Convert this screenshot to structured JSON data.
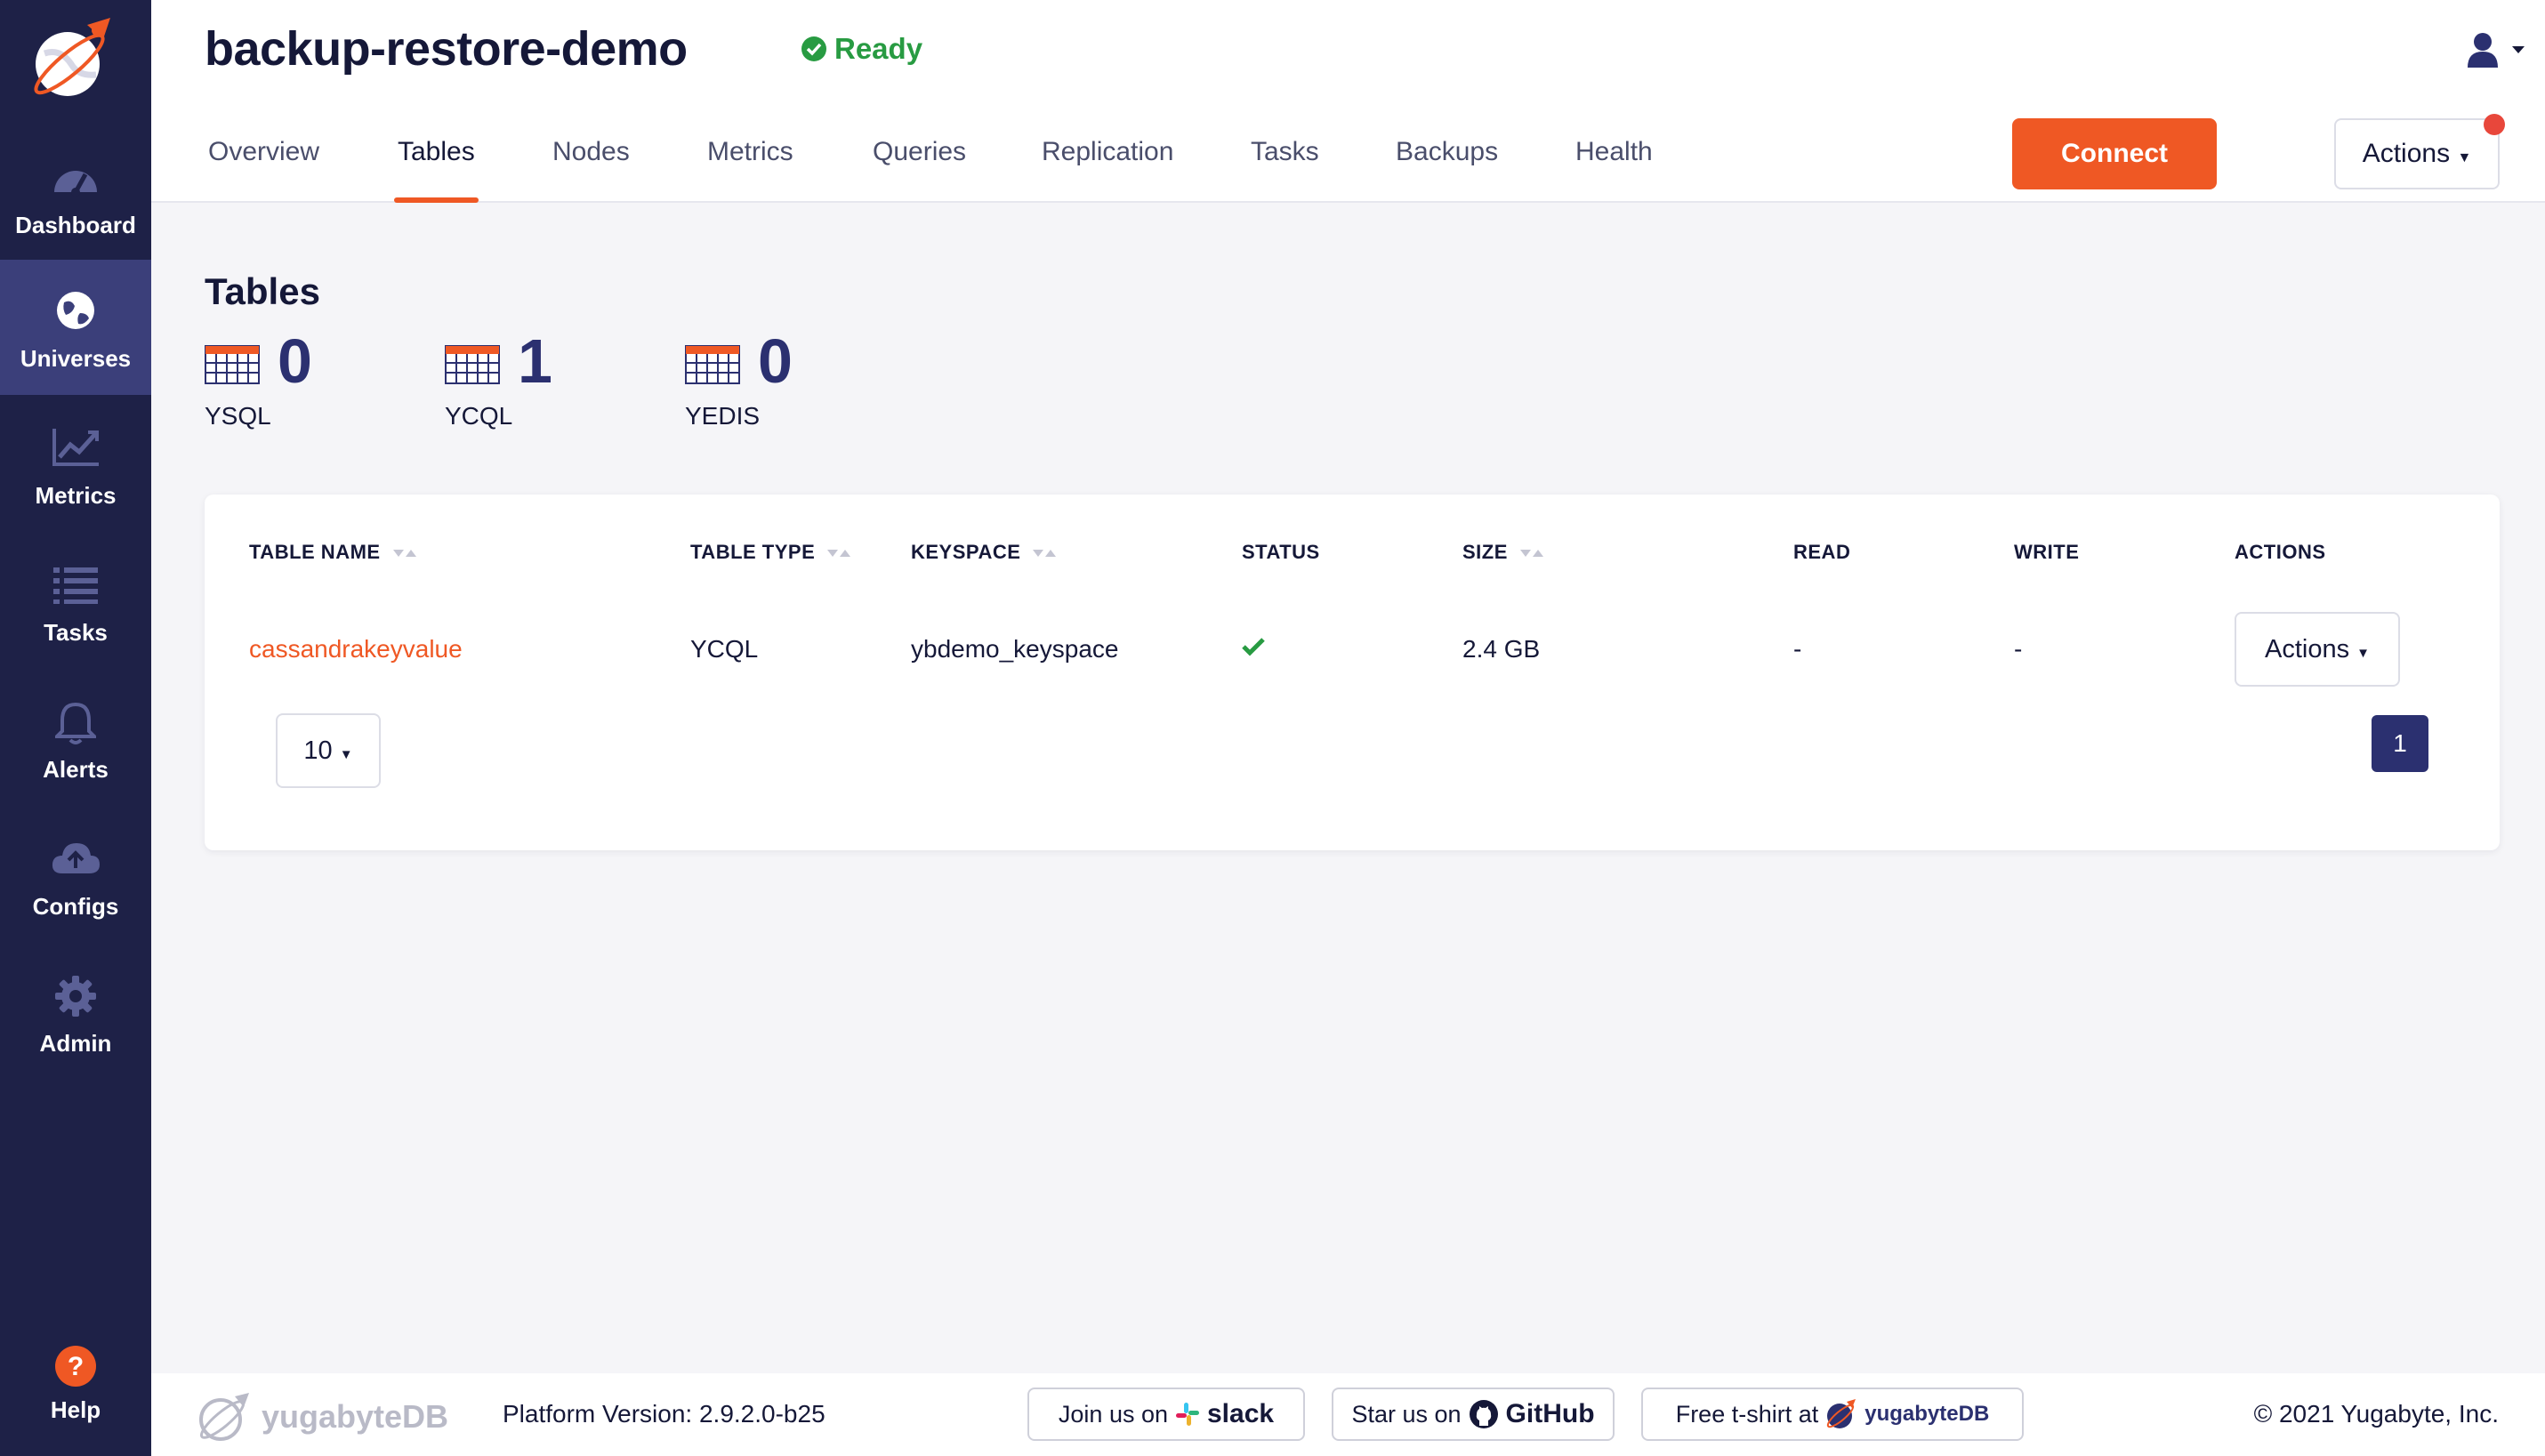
{
  "sidebar": {
    "items": [
      {
        "label": "Dashboard",
        "icon": "dashboard-icon"
      },
      {
        "label": "Universes",
        "icon": "globe-icon",
        "active": true
      },
      {
        "label": "Metrics",
        "icon": "chart-icon"
      },
      {
        "label": "Tasks",
        "icon": "list-icon"
      },
      {
        "label": "Alerts",
        "icon": "bell-icon"
      },
      {
        "label": "Configs",
        "icon": "cloud-upload-icon"
      },
      {
        "label": "Admin",
        "icon": "gear-icon"
      }
    ],
    "help_label": "Help"
  },
  "header": {
    "title": "backup-restore-demo",
    "status": "Ready",
    "connect_label": "Connect",
    "actions_label": "Actions",
    "tabs": [
      {
        "label": "Overview"
      },
      {
        "label": "Tables",
        "active": true
      },
      {
        "label": "Nodes"
      },
      {
        "label": "Metrics"
      },
      {
        "label": "Queries"
      },
      {
        "label": "Replication"
      },
      {
        "label": "Tasks"
      },
      {
        "label": "Backups"
      },
      {
        "label": "Health"
      }
    ]
  },
  "summary": {
    "title": "Tables",
    "stats": [
      {
        "count": "0",
        "label": "YSQL"
      },
      {
        "count": "1",
        "label": "YCQL"
      },
      {
        "count": "0",
        "label": "YEDIS"
      }
    ]
  },
  "table": {
    "columns": [
      "TABLE NAME",
      "TABLE TYPE",
      "KEYSPACE",
      "STATUS",
      "SIZE",
      "READ",
      "WRITE",
      "ACTIONS"
    ],
    "rows": [
      {
        "name": "cassandrakeyvalue",
        "type": "YCQL",
        "keyspace": "ybdemo_keyspace",
        "size": "2.4 GB",
        "read": "-",
        "write": "-",
        "actions_label": "Actions"
      }
    ],
    "page_size": "10",
    "page": "1"
  },
  "footer": {
    "brand_prefix": "yugabyte",
    "brand_suffix": "DB",
    "version": "Platform Version: 2.9.2.0-b25",
    "slack_text": "Join us on",
    "slack_brand": "slack",
    "github_text": "Star us on",
    "github_brand": "GitHub",
    "tshirt_text": "Free t-shirt at",
    "tshirt_brand": "yugabyteDB",
    "copyright": "© 2021 Yugabyte, Inc."
  },
  "colors": {
    "sidebar": "#1e2147",
    "sidebar_active": "#3b3f7a",
    "accent": "#ef5824",
    "status_ok": "#289b42",
    "primary_dark": "#2b3070"
  }
}
